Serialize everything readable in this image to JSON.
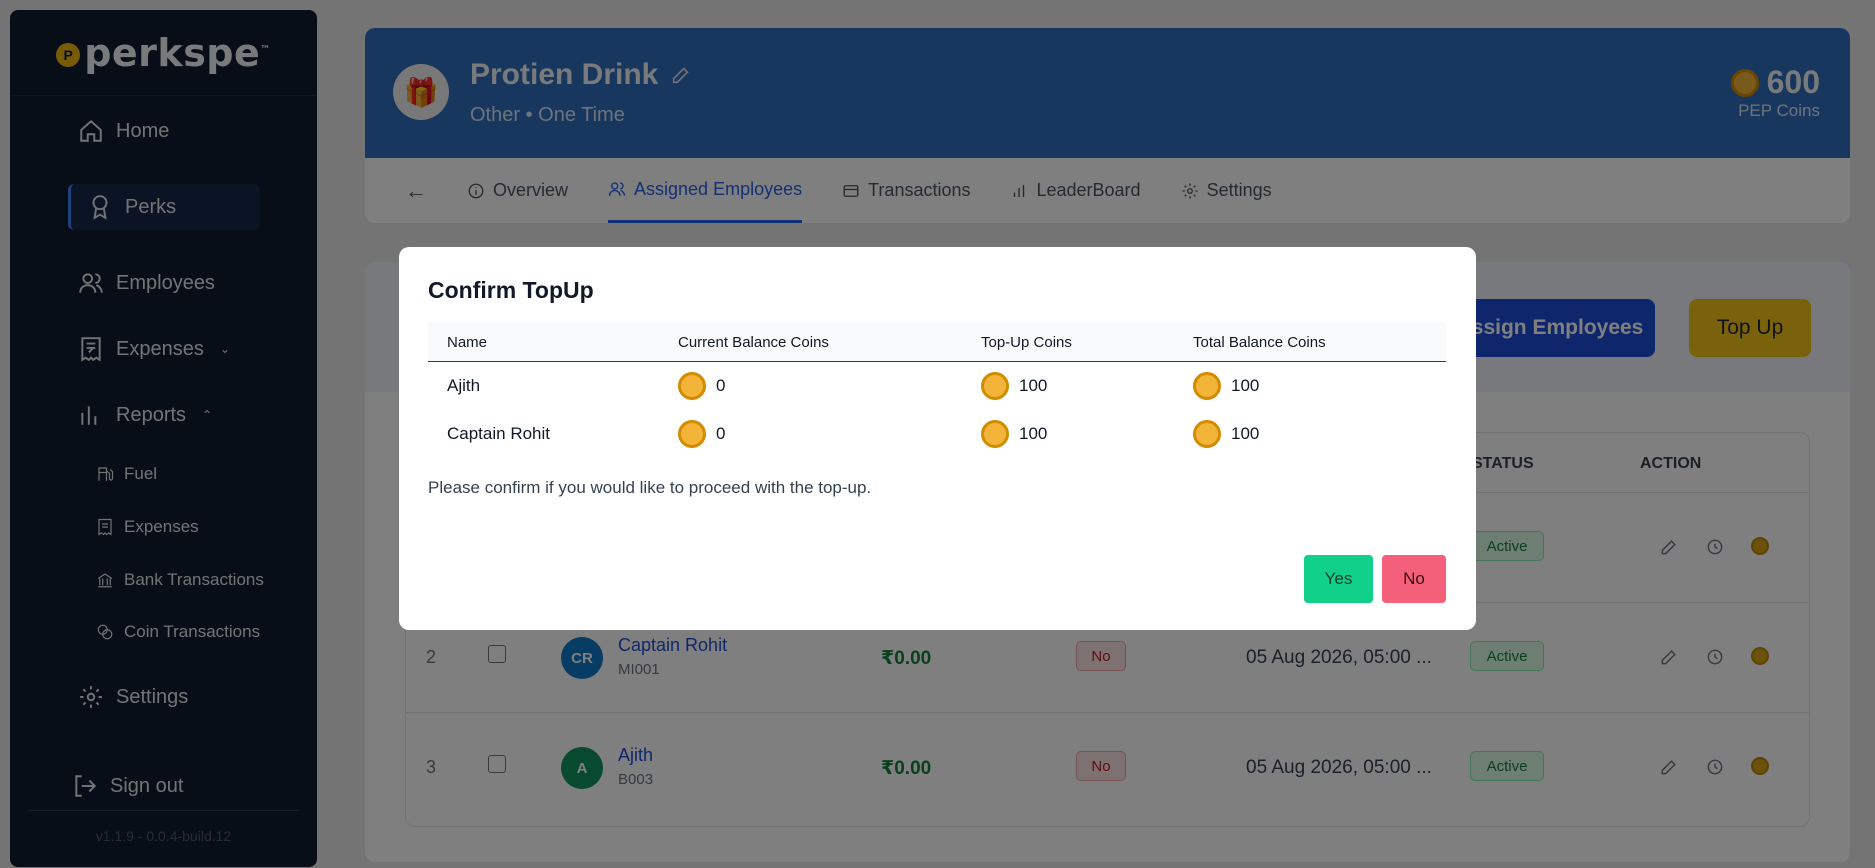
{
  "sidebar": {
    "logo_text": "perkspe",
    "logo_trademark": "™",
    "logo_badge": "P",
    "nav": {
      "home": "Home",
      "perks": "Perks",
      "employees": "Employees",
      "expenses": "Expenses",
      "reports": "Reports",
      "settings": "Settings",
      "signout": "Sign out"
    },
    "reports_sub": {
      "fuel": "Fuel",
      "expenses": "Expenses",
      "bank": "Bank Transactions",
      "coin": "Coin Transactions"
    },
    "version": "v1.1.9 - 0.0.4-build.12"
  },
  "perk": {
    "title": "Protien Drink",
    "subtitle": "Other • One Time",
    "coins_amount": "600",
    "coins_label": "PEP Coins"
  },
  "tabs": {
    "overview": "Overview",
    "assigned": "Assigned Employees",
    "transactions": "Transactions",
    "leaderboard": "LeaderBoard",
    "settings": "Settings"
  },
  "actions": {
    "assign_employees": "Assign Employees",
    "top_up": "Top Up"
  },
  "table": {
    "headers": {
      "status": "STATUS",
      "action": "ACTION"
    },
    "row1_status": "Active",
    "rows": [
      {
        "index": "2",
        "initials": "CR",
        "name": "Captain Rohit",
        "code": "MI001",
        "amount": "₹0.00",
        "flag": "No",
        "date": "05 Aug 2026, 05:00 ...",
        "status": "Active"
      },
      {
        "index": "3",
        "initials": "A",
        "name": "Ajith",
        "code": "B003",
        "amount": "₹0.00",
        "flag": "No",
        "date": "05 Aug 2026, 05:00 ...",
        "status": "Active"
      }
    ]
  },
  "modal": {
    "title": "Confirm TopUp",
    "headers": {
      "name": "Name",
      "current": "Current Balance Coins",
      "topup": "Top-Up Coins",
      "total": "Total Balance Coins"
    },
    "rows": [
      {
        "name": "Ajith",
        "current": "0",
        "topup": "100",
        "total": "100"
      },
      {
        "name": "Captain Rohit",
        "current": "0",
        "topup": "100",
        "total": "100"
      }
    ],
    "confirm_text": "Please confirm if you would like to proceed with the top-up.",
    "yes": "Yes",
    "no": "No"
  },
  "colors": {
    "sidebar_bg": "#0f1c31",
    "hero_bg": "#2f6ebd",
    "accent_blue": "#2563eb",
    "topup_yellow": "#f5c518",
    "yes_green": "#10d08a",
    "no_red": "#f4607a"
  }
}
